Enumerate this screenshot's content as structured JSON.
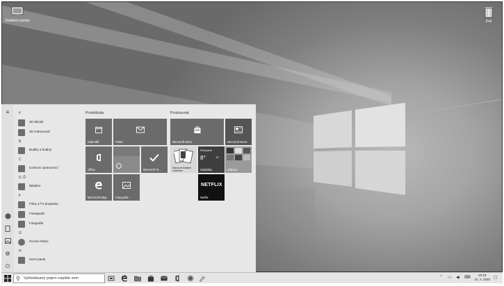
{
  "desktop": {
    "icon_this_pc": "Ovládací panely",
    "icon_recycle": "Koš"
  },
  "start_menu": {
    "letters": [
      "#",
      "B",
      "C",
      "D, Ď",
      "F",
      "G",
      "H"
    ],
    "apps": [
      {
        "label": "3D Skicák"
      },
      {
        "label": "3D zobrazovač"
      },
      {
        "label": "Budíky a hodiny"
      },
      {
        "label": "Centrum zpravomocí"
      },
      {
        "label": "Diktafon"
      },
      {
        "label": "Filmy a TV programy"
      },
      {
        "label": "Fotoaparát"
      },
      {
        "label": "Fotografie"
      },
      {
        "label": "Groove Music"
      },
      {
        "label": "Herní panel"
      }
    ],
    "groups": {
      "productivity": "Produktivita",
      "explore": "Prozkoumat"
    },
    "tiles": {
      "calendar": "Kalendář",
      "mail": "Pošta",
      "office": "Office",
      "skype": "",
      "todo": "Microsoft To...",
      "edge": "Microsoft Edge",
      "photos": "Fotografie",
      "store": "Microsoft Store",
      "news": "Microsoft News",
      "solitaire": "Microsoft Solitaire Collection",
      "weather_city": "Převážně",
      "weather_temp": "8°",
      "weather_temp2": "11°",
      "weather_label": "Statistika",
      "entertainment": "Zábava",
      "netflix": "Netflix",
      "netflix_logo": "NETFLIX"
    }
  },
  "taskbar": {
    "search_placeholder": "Vyhledávaný pojem napište sem",
    "time": "20:15",
    "date": "24. 2. 2020"
  },
  "colors": {
    "tile": "#6b6b6b",
    "tile_dark": "#4a4a4a",
    "start_bg": "#e7e7e7",
    "taskbar_bg": "#e5e5e5"
  }
}
